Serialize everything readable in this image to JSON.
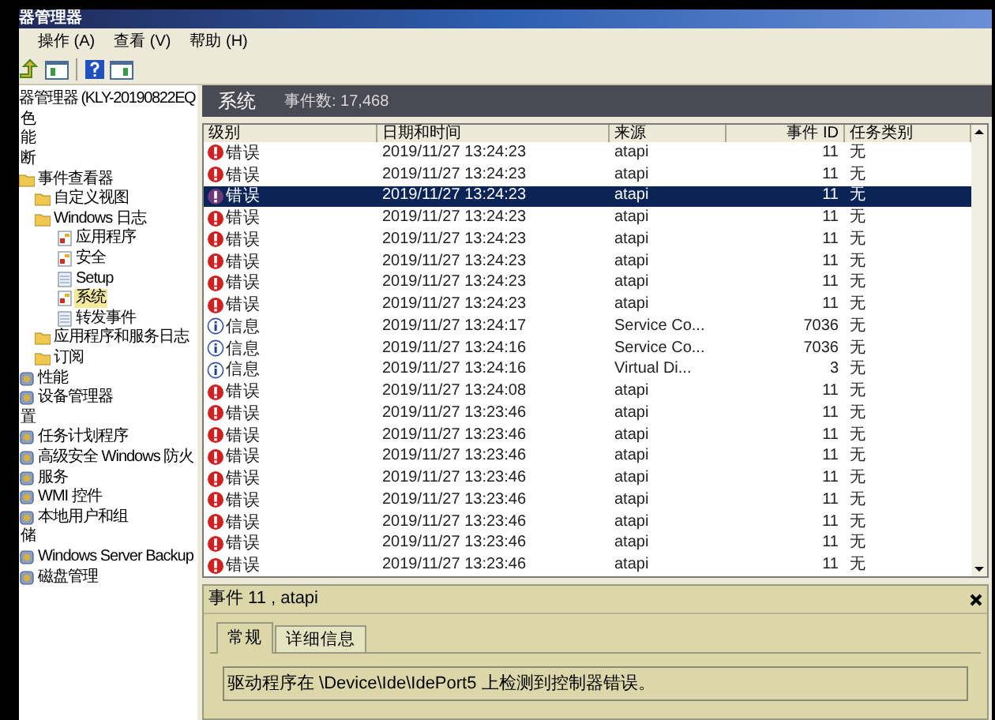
{
  "window": {
    "title": "器管理器"
  },
  "menu": [
    "操作 (A)",
    "查看 (V)",
    "帮助 (H)"
  ],
  "tree": [
    {
      "label": "器管理器 (KLY-20190822EQ",
      "selected": false,
      "children": [
        {
          "label": "色",
          "selected": false
        },
        {
          "label": "能",
          "selected": false
        },
        {
          "label": "断",
          "selected": false,
          "children": [
            {
              "label": "事件查看器",
              "kind": "folder",
              "selected": false,
              "children": [
                {
                  "label": "自定义视图",
                  "kind": "folder",
                  "selected": false
                },
                {
                  "label": "Windows 日志",
                  "kind": "folder",
                  "selected": false,
                  "children": [
                    {
                      "label": "应用程序",
                      "kind": "log",
                      "selected": false
                    },
                    {
                      "label": "安全",
                      "kind": "log",
                      "selected": false
                    },
                    {
                      "label": "Setup",
                      "kind": "plain",
                      "selected": false
                    },
                    {
                      "label": "系统",
                      "kind": "log",
                      "selected": true
                    },
                    {
                      "label": "转发事件",
                      "kind": "plain",
                      "selected": false
                    }
                  ]
                },
                {
                  "label": "应用程序和服务日志",
                  "kind": "folder",
                  "selected": false
                },
                {
                  "label": "订阅",
                  "kind": "folder",
                  "selected": false
                }
              ]
            },
            {
              "label": "性能",
              "kind": "tool",
              "selected": false
            },
            {
              "label": "设备管理器",
              "kind": "tool",
              "selected": false
            }
          ]
        },
        {
          "label": "置",
          "selected": false,
          "children": [
            {
              "label": "任务计划程序",
              "kind": "tool",
              "selected": false
            },
            {
              "label": "高级安全 Windows 防火",
              "kind": "tool",
              "selected": false
            },
            {
              "label": "服务",
              "kind": "tool",
              "selected": false
            },
            {
              "label": "WMI 控件",
              "kind": "tool",
              "selected": false
            },
            {
              "label": "本地用户和组",
              "kind": "tool",
              "selected": false
            }
          ]
        },
        {
          "label": "储",
          "selected": false,
          "children": [
            {
              "label": "Windows Server Backup",
              "kind": "tool",
              "selected": false
            },
            {
              "label": "磁盘管理",
              "kind": "tool",
              "selected": false
            }
          ]
        }
      ]
    }
  ],
  "log_header": {
    "title": "系统",
    "count": "事件数: 17,468"
  },
  "table": {
    "columns": [
      "级别",
      "日期和时间",
      "来源",
      "事件 ID",
      "任务类别"
    ],
    "rows": [
      {
        "kind": "error",
        "level": "错误",
        "datetime": "2019/11/27 13:24:23",
        "source": "atapi",
        "event_id": "11",
        "task_category": "无",
        "selected": false
      },
      {
        "kind": "error",
        "level": "错误",
        "datetime": "2019/11/27 13:24:23",
        "source": "atapi",
        "event_id": "11",
        "task_category": "无",
        "selected": false
      },
      {
        "kind": "error",
        "level": "错误",
        "datetime": "2019/11/27 13:24:23",
        "source": "atapi",
        "event_id": "11",
        "task_category": "无",
        "selected": true
      },
      {
        "kind": "error",
        "level": "错误",
        "datetime": "2019/11/27 13:24:23",
        "source": "atapi",
        "event_id": "11",
        "task_category": "无",
        "selected": false
      },
      {
        "kind": "error",
        "level": "错误",
        "datetime": "2019/11/27 13:24:23",
        "source": "atapi",
        "event_id": "11",
        "task_category": "无",
        "selected": false
      },
      {
        "kind": "error",
        "level": "错误",
        "datetime": "2019/11/27 13:24:23",
        "source": "atapi",
        "event_id": "11",
        "task_category": "无",
        "selected": false
      },
      {
        "kind": "error",
        "level": "错误",
        "datetime": "2019/11/27 13:24:23",
        "source": "atapi",
        "event_id": "11",
        "task_category": "无",
        "selected": false
      },
      {
        "kind": "error",
        "level": "错误",
        "datetime": "2019/11/27 13:24:23",
        "source": "atapi",
        "event_id": "11",
        "task_category": "无",
        "selected": false
      },
      {
        "kind": "info",
        "level": "信息",
        "datetime": "2019/11/27 13:24:17",
        "source": "Service Co...",
        "event_id": "7036",
        "task_category": "无",
        "selected": false
      },
      {
        "kind": "info",
        "level": "信息",
        "datetime": "2019/11/27 13:24:16",
        "source": "Service Co...",
        "event_id": "7036",
        "task_category": "无",
        "selected": false
      },
      {
        "kind": "info",
        "level": "信息",
        "datetime": "2019/11/27 13:24:16",
        "source": "Virtual Di...",
        "event_id": "3",
        "task_category": "无",
        "selected": false
      },
      {
        "kind": "error",
        "level": "错误",
        "datetime": "2019/11/27 13:24:08",
        "source": "atapi",
        "event_id": "11",
        "task_category": "无",
        "selected": false
      },
      {
        "kind": "error",
        "level": "错误",
        "datetime": "2019/11/27 13:23:46",
        "source": "atapi",
        "event_id": "11",
        "task_category": "无",
        "selected": false
      },
      {
        "kind": "error",
        "level": "错误",
        "datetime": "2019/11/27 13:23:46",
        "source": "atapi",
        "event_id": "11",
        "task_category": "无",
        "selected": false
      },
      {
        "kind": "error",
        "level": "错误",
        "datetime": "2019/11/27 13:23:46",
        "source": "atapi",
        "event_id": "11",
        "task_category": "无",
        "selected": false
      },
      {
        "kind": "error",
        "level": "错误",
        "datetime": "2019/11/27 13:23:46",
        "source": "atapi",
        "event_id": "11",
        "task_category": "无",
        "selected": false
      },
      {
        "kind": "error",
        "level": "错误",
        "datetime": "2019/11/27 13:23:46",
        "source": "atapi",
        "event_id": "11",
        "task_category": "无",
        "selected": false
      },
      {
        "kind": "error",
        "level": "错误",
        "datetime": "2019/11/27 13:23:46",
        "source": "atapi",
        "event_id": "11",
        "task_category": "无",
        "selected": false
      },
      {
        "kind": "error",
        "level": "错误",
        "datetime": "2019/11/27 13:23:46",
        "source": "atapi",
        "event_id": "11",
        "task_category": "无",
        "selected": false
      },
      {
        "kind": "error",
        "level": "错误",
        "datetime": "2019/11/27 13:23:46",
        "source": "atapi",
        "event_id": "11",
        "task_category": "无",
        "selected": false
      }
    ]
  },
  "detail": {
    "title": "事件 11 , atapi",
    "tabs": [
      {
        "label": "常规",
        "selected": true
      },
      {
        "label": "详细信息",
        "selected": false
      }
    ],
    "message": "驱动程序在 \\Device\\Ide\\IdePort5 上检测到控制器错误。"
  }
}
